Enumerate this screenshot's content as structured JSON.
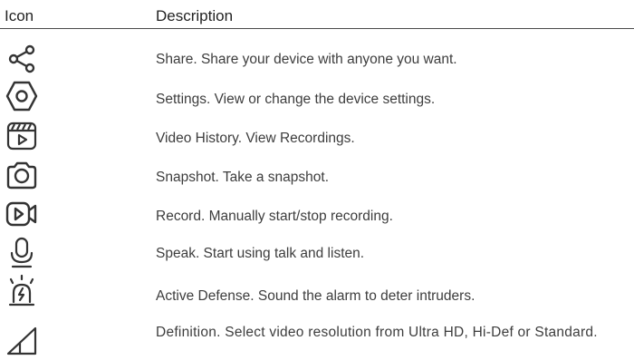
{
  "header": {
    "icon_col": "Icon",
    "desc_col": "Description"
  },
  "rows": [
    {
      "icon": "share-icon",
      "description": "Share. Share your device with anyone you want."
    },
    {
      "icon": "settings-icon",
      "description": "Settings. View or change the device settings."
    },
    {
      "icon": "video-history-icon",
      "description": "Video History. View Recordings."
    },
    {
      "icon": "camera-icon",
      "description": "Snapshot. Take a snapshot."
    },
    {
      "icon": "record-icon",
      "description": "Record. Manually start/stop recording."
    },
    {
      "icon": "microphone-icon",
      "description": "Speak. Start using talk and listen."
    },
    {
      "icon": "alarm-icon",
      "description": "Active Defense. Sound the alarm to deter intruders."
    },
    {
      "icon": "signal-resolution-icon",
      "description": "Definition. Select video resolution from Ultra HD, Hi-Def or Standard."
    }
  ],
  "colors": {
    "text": "#3d3d3d",
    "rule": "#4a4a4a"
  }
}
